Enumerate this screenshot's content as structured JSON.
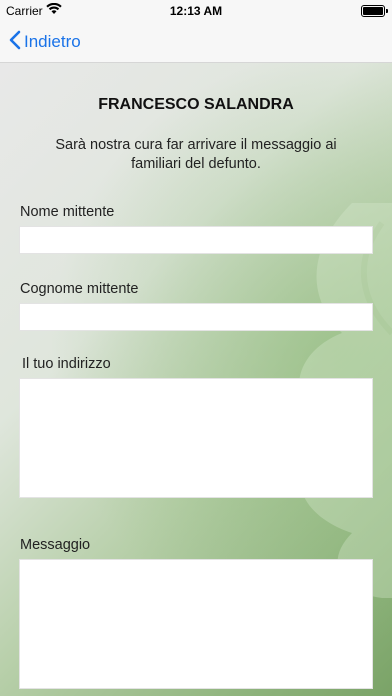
{
  "status_bar": {
    "carrier": "Carrier",
    "time": "12:13 AM"
  },
  "nav": {
    "back_label": "Indietro"
  },
  "form": {
    "title": "FRANCESCO SALANDRA",
    "subtitle": "Sarà nostra cura far arrivare il messaggio ai familiari del defunto.",
    "fields": {
      "first_name_label": "Nome mittente",
      "last_name_label": "Cognome mittente",
      "address_label": "Il tuo indirizzo",
      "message_label": "Messaggio"
    }
  },
  "icons": {
    "back": "chevron-left-icon",
    "wifi": "wifi-icon",
    "battery": "battery-icon"
  },
  "colors": {
    "accent": "#1a73e8",
    "background_green": "#8fb47d"
  }
}
